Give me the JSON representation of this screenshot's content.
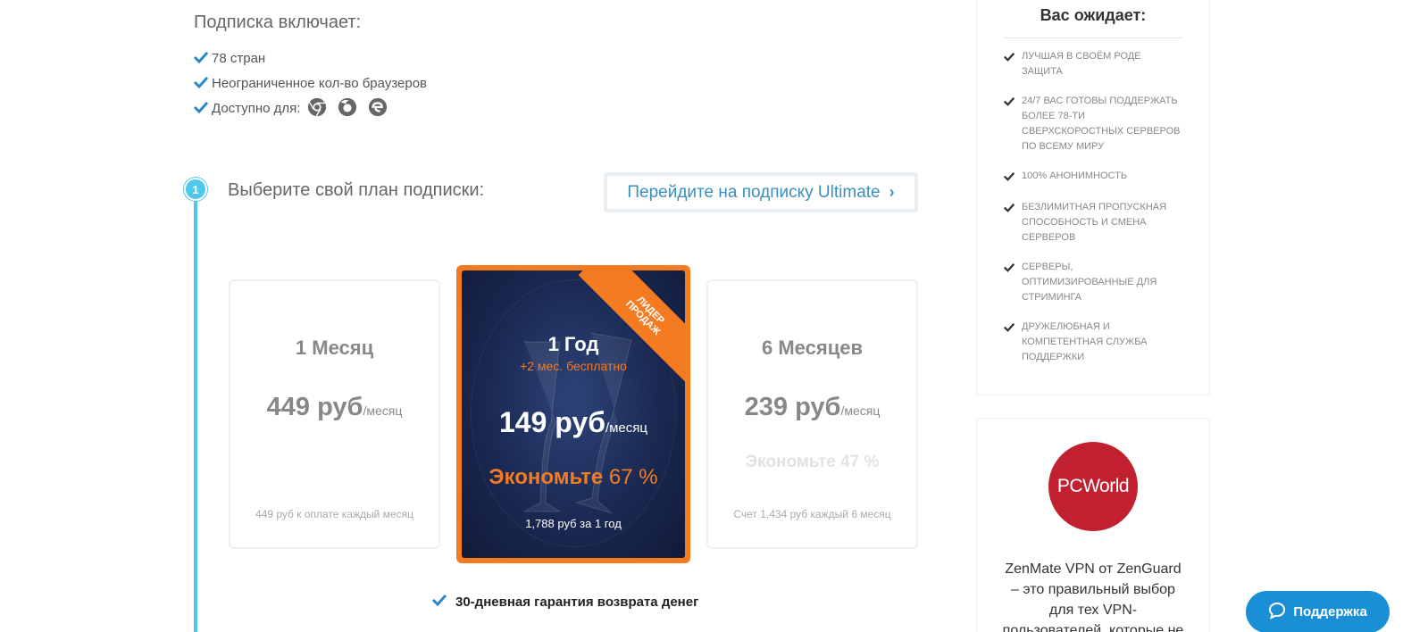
{
  "includes": {
    "title": "Подписка включает:",
    "items": [
      "78 стран",
      "Неограниченное кол-во браузеров"
    ],
    "available_label": "Доступно для:",
    "browsers": [
      "chrome-icon",
      "firefox-icon",
      "edge-icon"
    ]
  },
  "step": {
    "number": "1",
    "title": "Выберите свой план подписки:",
    "ultimate_label": "Перейдите на подписку Ultimate"
  },
  "plans": {
    "left": {
      "name": "1 Месяц",
      "price": "449 руб",
      "per": "/месяц",
      "note": "449 руб к оплате каждый месяц"
    },
    "featured": {
      "ribbon_line1": "Лидер",
      "ribbon_line2": "продаж",
      "name": "1 Год",
      "bonus": "+2 мес. бесплатно",
      "price": "149 руб",
      "per": "/месяц",
      "save_label": "Экономьте",
      "save_value": "67 %",
      "note": "1,788 руб за 1 год"
    },
    "right": {
      "name": "6 Месяцев",
      "price": "239 руб",
      "per": "/месяц",
      "save": "Экономьте 47 %",
      "note": "Счет 1,434 руб каждый 6 месяц"
    }
  },
  "guarantee": "30-дневная гарантия возврата денег",
  "expect": {
    "title": "Вас ожидает:",
    "items": [
      "Лучшая в своём роде защита",
      "24/7 вас готовы поддержать более 78-ти сверхскоростных серверов по всему миру",
      "100% анонимность",
      "Безлимитная пропускная способность и смена серверов",
      "Серверы, оптимизированные для стриминга",
      "Дружелюбная и компетентная служба поддержки"
    ]
  },
  "review": {
    "logo": "PCWorld",
    "text": "ZenMate VPN от ZenGuard – это правильный выбор для тех VPN-пользователей, которые не"
  },
  "support": {
    "label": "Поддержка"
  },
  "colors": {
    "accent": "#4dc7ea",
    "orange": "#f47b20",
    "link": "#3a8fc1",
    "support": "#1a8fd6",
    "pcworld": "#c0202f"
  }
}
